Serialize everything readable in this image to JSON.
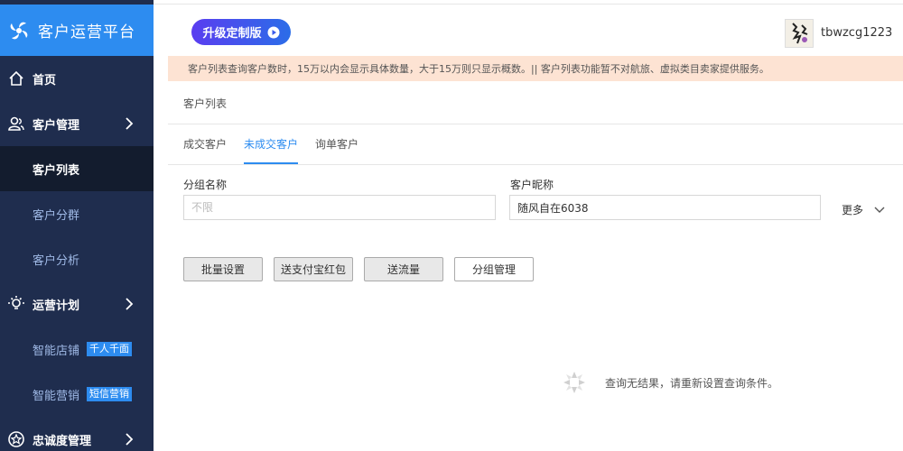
{
  "app": {
    "title": "客户运营平台"
  },
  "sidebar": {
    "items": [
      {
        "label": "首页"
      },
      {
        "label": "客户管理"
      },
      {
        "label": "客户列表"
      },
      {
        "label": "客户分群"
      },
      {
        "label": "客户分析"
      },
      {
        "label": "运营计划"
      },
      {
        "label": "智能店铺",
        "badge": "千人千面"
      },
      {
        "label": "智能营销",
        "badge": "短信营销"
      },
      {
        "label": "忠诚度管理"
      }
    ]
  },
  "header": {
    "upgrade_label": "升级定制版",
    "username": "tbwzcg1223"
  },
  "notice": "客户列表查询客户数时，15万以内会显示具体数量，大于15万则只显示概数。|| 客户列表功能暂不对航旅、虚拟类目卖家提供服务。",
  "breadcrumb": "客户列表",
  "tabs": [
    {
      "label": "成交客户"
    },
    {
      "label": "未成交客户"
    },
    {
      "label": "询单客户"
    }
  ],
  "filters": {
    "group": {
      "label": "分组名称",
      "placeholder": "不限"
    },
    "nickname": {
      "label": "客户昵称",
      "value": "随风自在6038"
    },
    "more_label": "更多"
  },
  "actions": {
    "batch": "批量设置",
    "alipay": "送支付宝红包",
    "traffic": "送流量",
    "group_manage": "分组管理"
  },
  "empty_message": "查询无结果，请重新设置查询条件。",
  "colors": {
    "sidebar_bg": "#1f2d4e",
    "brand_blue": "#2d8cf0",
    "notice_bg": "#fde3d3"
  }
}
